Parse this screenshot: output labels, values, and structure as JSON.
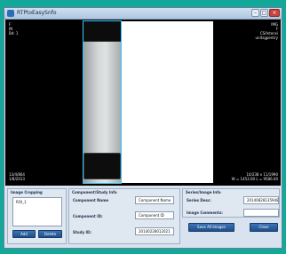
{
  "window": {
    "title": "RTPtoEasySnfo"
  },
  "viewer": {
    "overlay_top_left": "F\nIN\nBd: 1",
    "overlay_top_right": "IMG\nF\nCS/Intensi\nunitsgpentry",
    "overlay_bottom_left": "13/4/864\n1/8/2013",
    "overlay_bottom_right": "10/238 x 11/1990\nW = 1453.00 L = 9586.00"
  },
  "image_cropping": {
    "title": "Image Cropping",
    "list_items": [
      "ROI_1"
    ],
    "add_label": "Add",
    "delete_label": "Delete"
  },
  "component": {
    "title": "Component/Study Info",
    "name_label": "Component Name",
    "name_value": "Component Name",
    "id_label": "Component ID:",
    "id_value": "Component ID",
    "study_label": "Study ID:",
    "study_value": "20140228012021"
  },
  "series": {
    "title": "Series/Image Info",
    "desc_label": "Series Desc:",
    "desc_value": "20140828135948",
    "comments_label": "Image Comments:",
    "comments_value": ""
  },
  "actions": {
    "save_all_label": "Save All Images",
    "close_label": "Close"
  },
  "colors": {
    "accent": "#2a5e9e",
    "crop_outline": "#34c8ff",
    "background": "#12a89a"
  }
}
